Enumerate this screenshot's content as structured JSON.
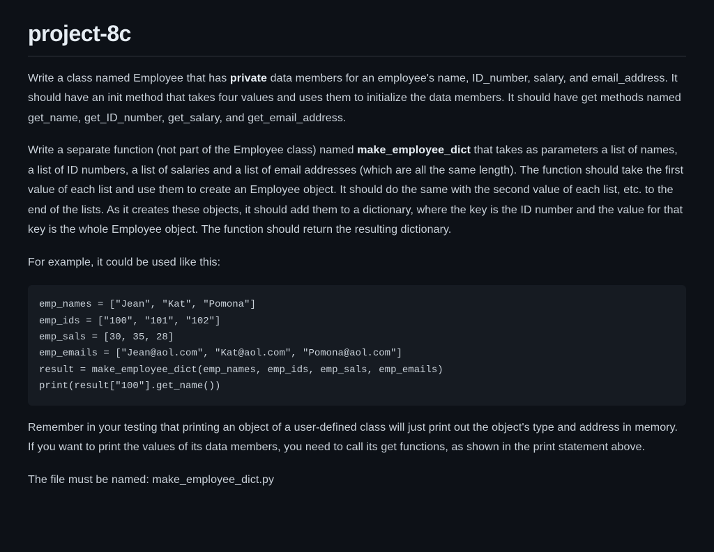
{
  "title": "project-8c",
  "paragraphs": {
    "p1_a": "Write a class named Employee that has ",
    "p1_bold": "private",
    "p1_b": " data members for an employee's name, ID_number, salary, and email_address. It should have an init method that takes four values and uses them to initialize the data members. It should have get methods named get_name, get_ID_number, get_salary, and get_email_address.",
    "p2_a": "Write a separate function (not part of the Employee class) named ",
    "p2_bold": "make_employee_dict",
    "p2_b": " that takes as parameters a list of names, a list of ID numbers, a list of salaries and a list of email addresses (which are all the same length). The function should take the first value of each list and use them to create an Employee object. It should do the same with the second value of each list, etc. to the end of the lists. As it creates these objects, it should add them to a dictionary, where the key is the ID number and the value for that key is the whole Employee object. The function should return the resulting dictionary.",
    "p3": "For example, it could be used like this:",
    "p4": "Remember in your testing that printing an object of a user-defined class will just print out the object's type and address in memory. If you want to print the values of its data members, you need to call its get functions, as shown in the print statement above.",
    "p5": "The file must be named: make_employee_dict.py"
  },
  "code": "emp_names = [\"Jean\", \"Kat\", \"Pomona\"]\nemp_ids = [\"100\", \"101\", \"102\"]\nemp_sals = [30, 35, 28]\nemp_emails = [\"Jean@aol.com\", \"Kat@aol.com\", \"Pomona@aol.com\"]\nresult = make_employee_dict(emp_names, emp_ids, emp_sals, emp_emails)\nprint(result[\"100\"].get_name())"
}
